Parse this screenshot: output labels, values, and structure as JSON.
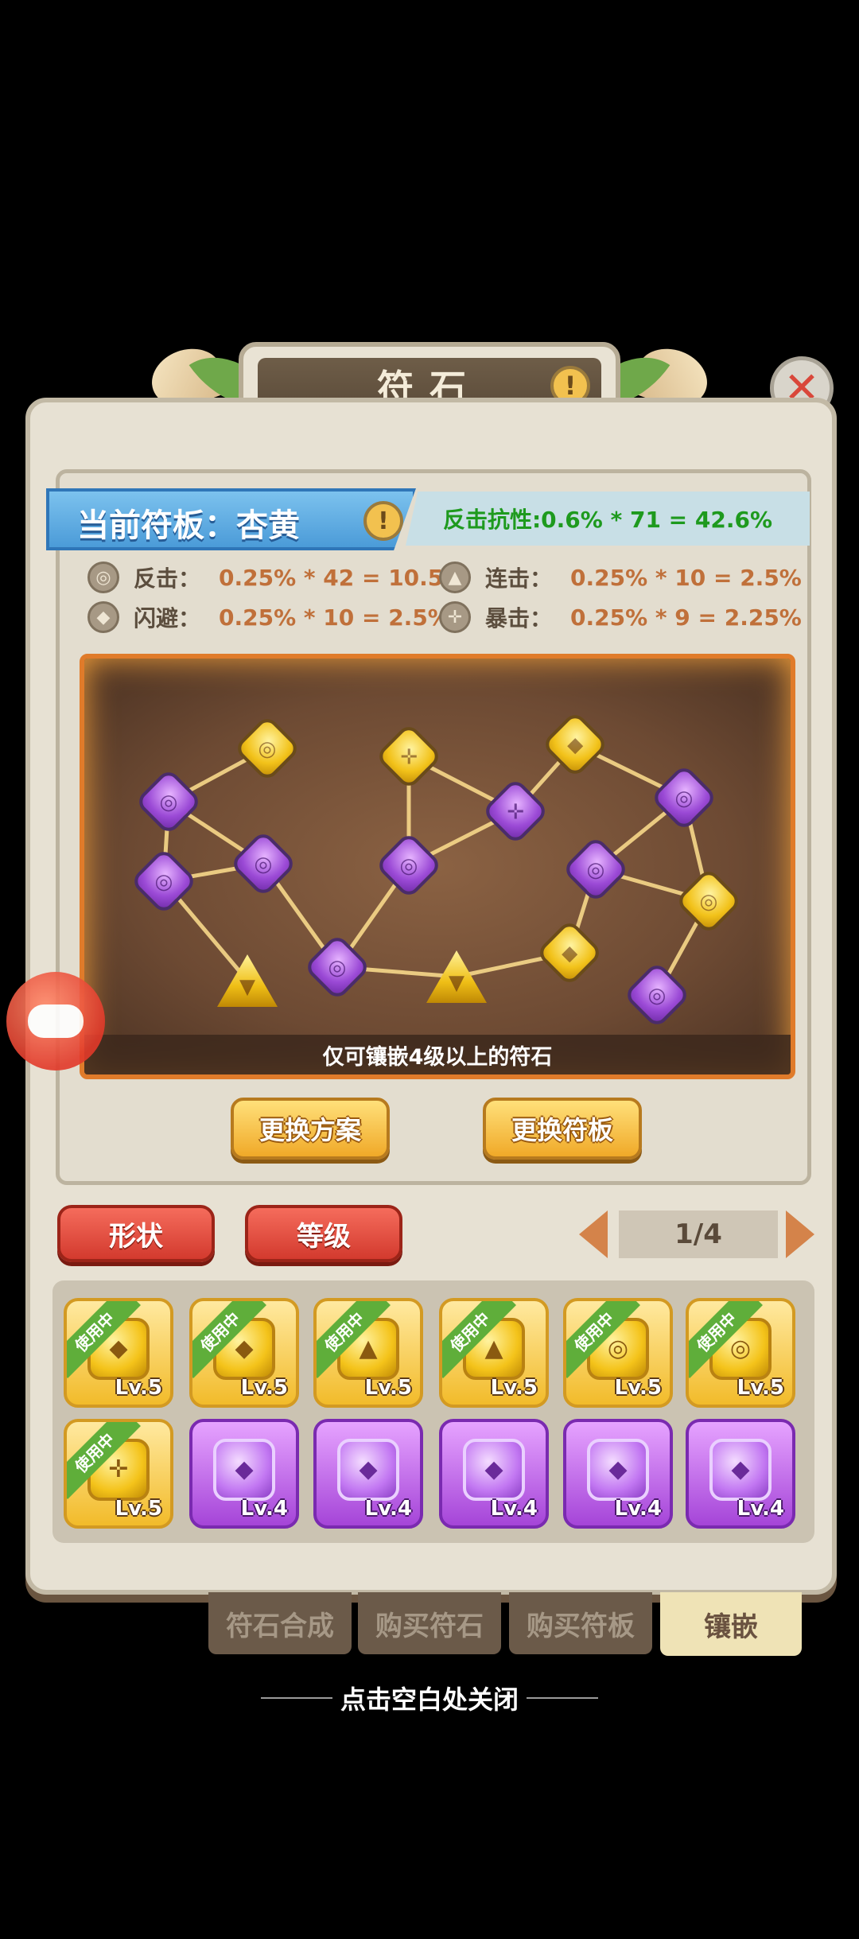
{
  "title": "符石",
  "title_info_icon": "!",
  "board": {
    "name_label": "当前符板：杏黄",
    "resist_text": "反击抗性:0.6% * 71 = 42.6%",
    "note": "仅可镶嵌4级以上的符石"
  },
  "stats": [
    {
      "icon": "spiral-icon",
      "label": "反击：",
      "value": "0.25% * 42 = 10.5%"
    },
    {
      "icon": "triangle-icon",
      "label": "连击：",
      "value": "0.25% * 10 = 2.5%"
    },
    {
      "icon": "diamond-icon",
      "label": "闪避：",
      "value": "0.25% * 10 = 2.5%"
    },
    {
      "icon": "crosshair-icon",
      "label": "暴击：",
      "value": "0.25% * 9 = 2.25%"
    }
  ],
  "buttons": {
    "change_plan": "更换方案",
    "change_board": "更换符板",
    "shape": "形状",
    "level": "等级"
  },
  "pager": "1/4",
  "inventory": [
    {
      "color": "gold",
      "symbol": "◆",
      "level": "Lv.5",
      "tag": "使用中"
    },
    {
      "color": "gold",
      "symbol": "◆",
      "level": "Lv.5",
      "tag": "使用中"
    },
    {
      "color": "gold",
      "symbol": "▲",
      "level": "Lv.5",
      "tag": "使用中"
    },
    {
      "color": "gold",
      "symbol": "▲",
      "level": "Lv.5",
      "tag": "使用中"
    },
    {
      "color": "gold",
      "symbol": "◎",
      "level": "Lv.5",
      "tag": "使用中"
    },
    {
      "color": "gold",
      "symbol": "◎",
      "level": "Lv.5",
      "tag": "使用中"
    },
    {
      "color": "gold",
      "symbol": "✛",
      "level": "Lv.5",
      "tag": "使用中"
    },
    {
      "color": "purple",
      "symbol": "◆",
      "level": "Lv.4",
      "tag": ""
    },
    {
      "color": "purple",
      "symbol": "◆",
      "level": "Lv.4",
      "tag": ""
    },
    {
      "color": "purple",
      "symbol": "◆",
      "level": "Lv.4",
      "tag": ""
    },
    {
      "color": "purple",
      "symbol": "◆",
      "level": "Lv.4",
      "tag": ""
    },
    {
      "color": "purple",
      "symbol": "◆",
      "level": "Lv.4",
      "tag": ""
    }
  ],
  "tabs": [
    {
      "label": "符石合成",
      "active": false
    },
    {
      "label": "购买符石",
      "active": false
    },
    {
      "label": "购买符板",
      "active": false
    },
    {
      "label": "镶嵌",
      "active": true
    }
  ],
  "close_hint": "点击空白处关闭",
  "colors": {
    "accent_blue": "#4b9bd8",
    "stat_value": "#c0703a",
    "resist_green": "#1e9a1e",
    "tab_active": "#efe3b6"
  }
}
